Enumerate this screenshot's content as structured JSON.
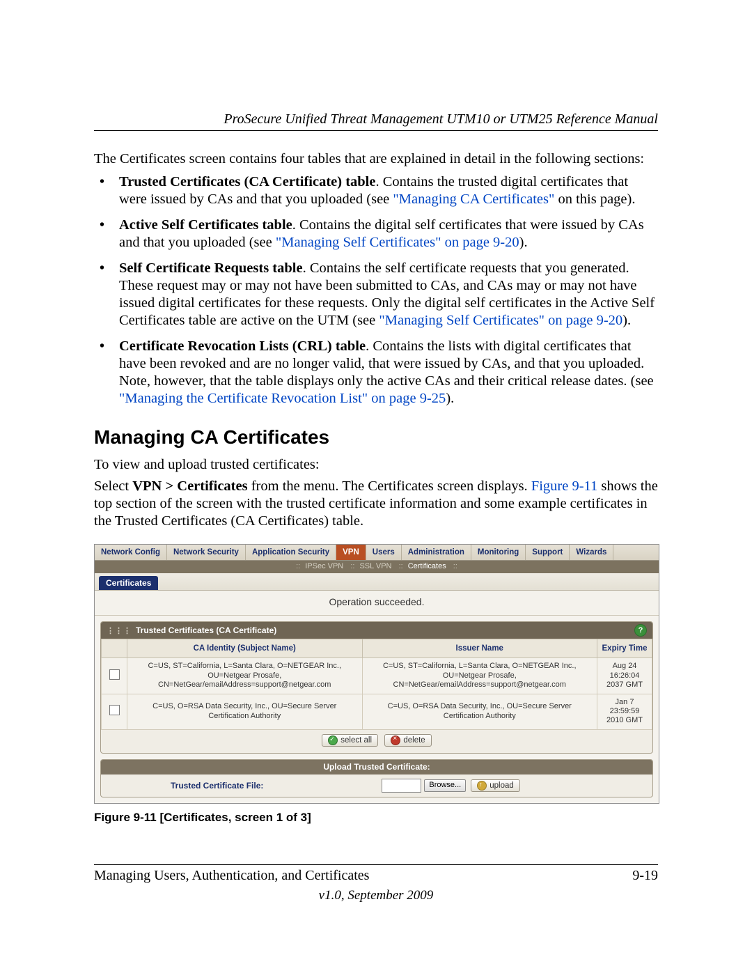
{
  "header": {
    "running": "ProSecure Unified Threat Management UTM10 or UTM25 Reference Manual"
  },
  "intro": "The Certificates screen contains four tables that are explained in detail in the following sections:",
  "bullets": [
    {
      "lead": "Trusted Certificates (CA Certificate) table",
      "text1": ". Contains the trusted digital certificates that were issued by CAs and that you uploaded (see ",
      "link": "\"Managing CA Certificates\"",
      "text2": " on this page)."
    },
    {
      "lead": "Active Self Certificates table",
      "text1": ". Contains the digital self certificates that were issued by CAs and that you uploaded (see ",
      "link": "\"Managing Self Certificates\" on page 9-20",
      "text2": ")."
    },
    {
      "lead": "Self Certificate Requests table",
      "text1": ". Contains the self certificate requests that you generated. These request may or may not have been submitted to CAs, and CAs may or may not have issued digital certificates for these requests. Only the digital self certificates in the Active Self Certificates table are active on the UTM (see ",
      "link": "\"Managing Self Certificates\" on page 9-20",
      "text2": ")."
    },
    {
      "lead": "Certificate Revocation Lists (CRL) table",
      "text1": ". Contains the lists with digital certificates that have been revoked and are no longer valid, that were issued by CAs, and that you uploaded. Note, however, that the table displays only the active CAs and their critical release dates. (see ",
      "link": "\"Managing the Certificate Revocation List\" on page 9-25",
      "text2": ")."
    }
  ],
  "section_heading": "Managing CA Certificates",
  "para1": "To view and upload trusted certificates:",
  "para2a": "Select ",
  "para2b": "VPN > Certificates",
  "para2c": " from the menu. The Certificates screen displays. ",
  "para2link": "Figure 9-11",
  "para2d": " shows the top section of the screen with the trusted certificate information and some example certificates in the Trusted Certificates (CA Certificates) table.",
  "ui": {
    "tabs1": [
      "Network Config",
      "Network Security",
      "Application Security",
      "VPN",
      "Users",
      "Administration",
      "Monitoring",
      "Support",
      "Wizards"
    ],
    "tabs2": {
      "a": "IPSec VPN",
      "b": "SSL VPN",
      "c": "Certificates"
    },
    "subtab": "Certificates",
    "status": "Operation succeeded.",
    "block1_title": "Trusted Certificates (CA Certificate)",
    "cols": {
      "c1": "CA Identity (Subject Name)",
      "c2": "Issuer Name",
      "c3": "Expiry Time"
    },
    "rows": [
      {
        "subj": "C=US, ST=California, L=Santa Clara, O=NETGEAR Inc., OU=Netgear Prosafe, CN=NetGear/emailAddress=support@netgear.com",
        "issuer": "C=US, ST=California, L=Santa Clara, O=NETGEAR Inc., OU=Netgear Prosafe, CN=NetGear/emailAddress=support@netgear.com",
        "exp": "Aug 24 16:26:04 2037 GMT"
      },
      {
        "subj": "C=US, O=RSA Data Security, Inc., OU=Secure Server Certification Authority",
        "issuer": "C=US, O=RSA Data Security, Inc., OU=Secure Server Certification Authority",
        "exp": "Jan 7 23:59:59 2010 GMT"
      }
    ],
    "btn_select": "select all",
    "btn_delete": "delete",
    "upload_header": "Upload Trusted Certificate:",
    "upload_label": "Trusted Certificate File:",
    "browse": "Browse...",
    "upload": "upload"
  },
  "figure_caption": "Figure 9-11 [Certificates, screen 1 of 3]",
  "footer": {
    "left": "Managing Users, Authentication, and Certificates",
    "right": "9-19",
    "version": "v1.0, September 2009"
  }
}
